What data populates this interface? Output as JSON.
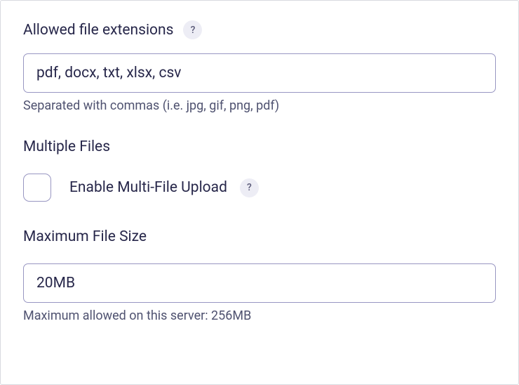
{
  "allowed_extensions": {
    "label": "Allowed file extensions",
    "help": "?",
    "value": "pdf, docx, txt, xlsx, csv",
    "helper": "Separated with commas (i.e. jpg, gif, png, pdf)"
  },
  "multiple_files": {
    "heading": "Multiple Files",
    "checkbox_label": "Enable Multi-File Upload",
    "help": "?"
  },
  "max_file_size": {
    "heading": "Maximum File Size",
    "value": "20MB",
    "helper": "Maximum allowed on this server: 256MB"
  }
}
